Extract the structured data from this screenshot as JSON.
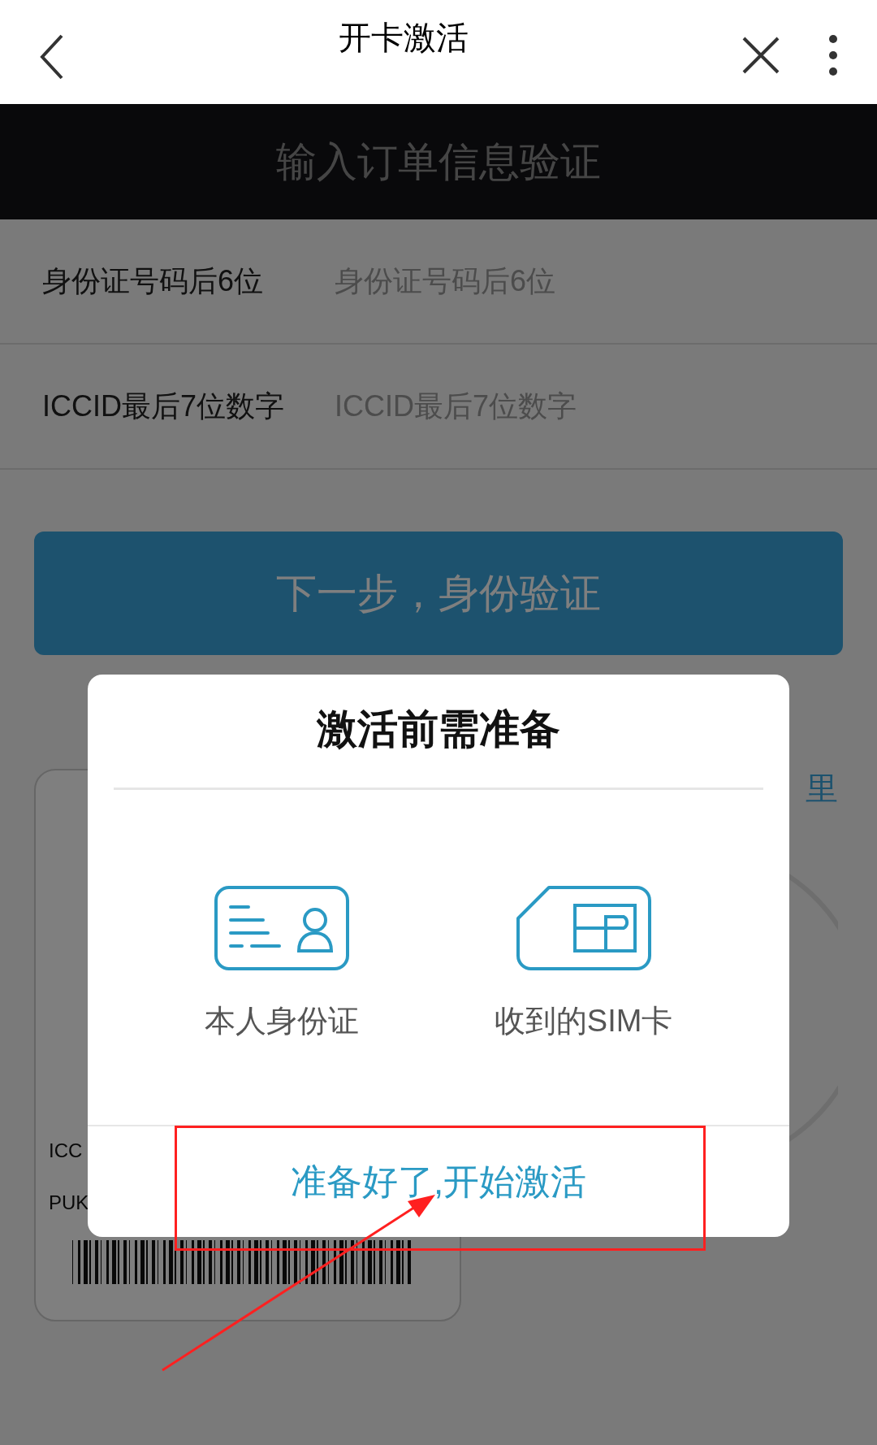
{
  "header": {
    "title": "开卡激活"
  },
  "banner": {
    "title": "输入订单信息验证"
  },
  "form": {
    "fields": [
      {
        "label": "身份证号码后6位",
        "placeholder": "身份证号码后6位"
      },
      {
        "label": "ICCID最后7位数字",
        "placeholder": "ICCID最后7位数字"
      }
    ]
  },
  "next_button": "下一步，身份验证",
  "background_link": "里",
  "sim_card": {
    "lines": [
      "ICC",
      "PUK"
    ]
  },
  "dialog": {
    "title": "激活前需准备",
    "items": [
      {
        "kind": "id-card",
        "label": "本人身份证"
      },
      {
        "kind": "sim-card",
        "label": "收到的SIM卡"
      }
    ],
    "confirm_button": "准备好了,开始激活"
  }
}
